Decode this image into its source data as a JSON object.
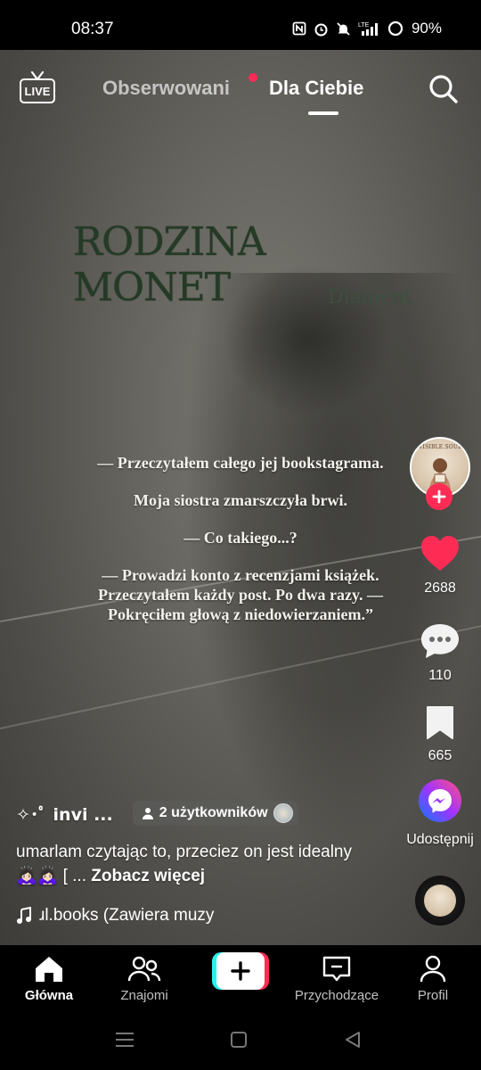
{
  "status_bar": {
    "time": "08:37",
    "network": "LTE",
    "battery": "90%"
  },
  "top_nav": {
    "live_label": "LIVE",
    "tab_following": "Obserwowani",
    "tab_for_you": "Dla Ciebie"
  },
  "video": {
    "book_title": "RODZINA MONET",
    "book_subtitle": "Diament",
    "quote_lines": [
      "— Przeczytałem całego jej bookstagrama.",
      "Moja siostra zmarszczyła brwi.",
      "— Co takiego...?",
      "— Prowadzi konto z recenzjami książek. Przeczytałem każdy post. Po dwa razy. — Pokręciłem głową z niedowierzaniem.”"
    ]
  },
  "rail": {
    "avatar_text": "INVISIBLE.SOUL.BOOKS",
    "likes": "2688",
    "comments": "110",
    "saves": "665",
    "share_label": "Udostępnij",
    "colors": {
      "like": "#fe2c55",
      "follow": "#fe2c55"
    }
  },
  "post": {
    "author": "✧･ﾟ invi ...",
    "users_pill": "2 użytkowników",
    "caption": "umarlam czytając to, przeciez on jest idealny🙇🏻‍♀️🙇🏻‍♀️ [ ...",
    "see_more": "Zobacz więcej",
    "music": "ɹl.books (Zawiera muzy"
  },
  "tabbar": {
    "home": "Główna",
    "friends": "Znajomi",
    "inbox": "Przychodzące",
    "profile": "Profil"
  }
}
